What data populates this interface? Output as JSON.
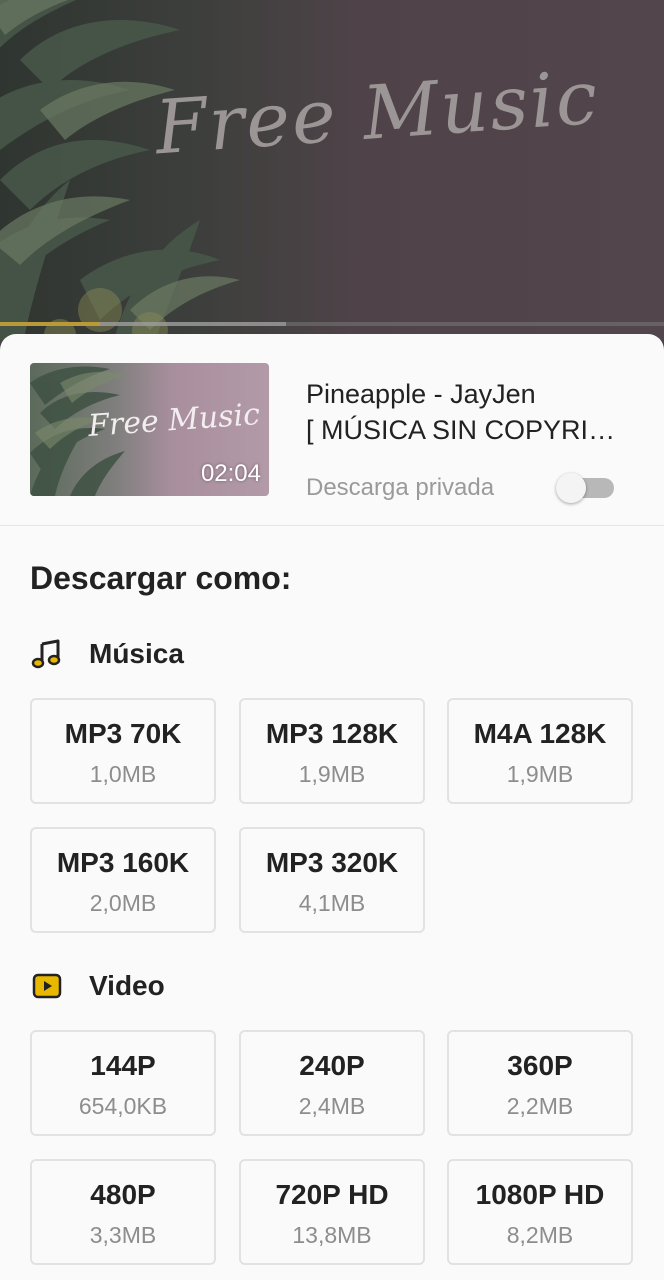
{
  "player": {
    "background_logo_text": "Free Music",
    "progress_fraction": 0.15,
    "buffer_fraction": 0.43
  },
  "video": {
    "thumbnail_logo_text": "Free Music",
    "duration": "02:04",
    "title_line1": "Pineapple - JayJen",
    "title_line2": "[ MÚSICA SIN COPYRIGHT ]",
    "private_label": "Descarga privada",
    "private_enabled": false
  },
  "download": {
    "heading": "Descargar como:",
    "music": {
      "label": "Música",
      "icon": "music-note-icon",
      "options": [
        {
          "quality": "MP3 70K",
          "size": "1,0MB"
        },
        {
          "quality": "MP3 128K",
          "size": "1,9MB"
        },
        {
          "quality": "M4A 128K",
          "size": "1,9MB"
        },
        {
          "quality": "MP3 160K",
          "size": "2,0MB"
        },
        {
          "quality": "MP3 320K",
          "size": "4,1MB"
        }
      ]
    },
    "video": {
      "label": "Video",
      "icon": "play-box-icon",
      "options": [
        {
          "quality": "144P",
          "size": "654,0KB"
        },
        {
          "quality": "240P",
          "size": "2,4MB"
        },
        {
          "quality": "360P",
          "size": "2,2MB"
        },
        {
          "quality": "480P",
          "size": "3,3MB"
        },
        {
          "quality": "720P HD",
          "size": "13,8MB"
        },
        {
          "quality": "1080P HD",
          "size": "8,2MB"
        }
      ]
    }
  },
  "colors": {
    "accent": "#e8b800",
    "progress": "#b99a38",
    "sheet_background": "#fafafa"
  }
}
